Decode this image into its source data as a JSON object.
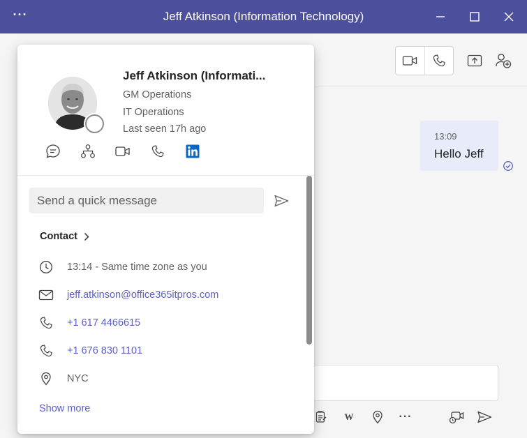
{
  "window": {
    "title": "Jeff Atkinson (Information Technology)",
    "more_glyph": "···"
  },
  "chat": {
    "message": {
      "time": "13:09",
      "text": "Hello Jeff"
    }
  },
  "composer": {
    "wiki_glyph": "W",
    "more_glyph": "···"
  },
  "profile": {
    "name": "Jeff Atkinson (Informati...",
    "job_title": "GM Operations",
    "department": "IT Operations",
    "last_seen": "Last seen 17h ago",
    "presence": "offline",
    "quick_message_placeholder": "Send a quick message",
    "contact_heading": "Contact",
    "contact_rows": [
      {
        "icon": "clock-icon",
        "text": "13:14 - Same time zone as you"
      },
      {
        "icon": "mail-icon",
        "text": "jeff.atkinson@office365itpros.com"
      },
      {
        "icon": "phone-icon",
        "text": "+1 617 4466615"
      },
      {
        "icon": "phone-icon",
        "text": "+1 676 830 1101"
      },
      {
        "icon": "location-icon",
        "text": "NYC"
      }
    ],
    "show_more": "Show more"
  },
  "colors": {
    "titlebar": "#4b4f9c",
    "accent": "#5b5fc7",
    "bubble": "#e8ebfa",
    "linkedin": "#0a66c2"
  }
}
